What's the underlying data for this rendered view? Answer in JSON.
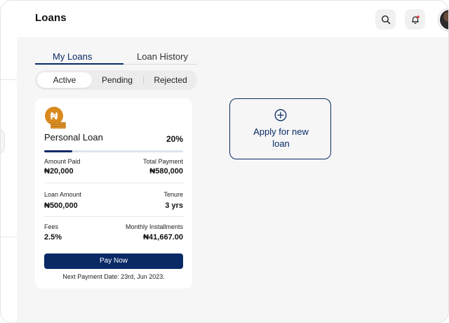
{
  "header": {
    "title": "Loans",
    "icons": [
      "search-icon",
      "bell-icon",
      "avatar"
    ],
    "notification_dot_color": "#e53935"
  },
  "tabs": [
    {
      "label": "My Loans",
      "selected": true
    },
    {
      "label": "Loan History",
      "selected": false
    }
  ],
  "status_filter": [
    {
      "label": "Active",
      "selected": true
    },
    {
      "label": "Pending",
      "selected": false
    },
    {
      "label": "Rejected",
      "selected": false
    }
  ],
  "loan_card": {
    "currency_symbol": "₦",
    "name": "Personal Loan",
    "progress_percent_label": "20%",
    "progress_fraction": 0.2,
    "amount_paid_label": "Amount Paid",
    "amount_paid": "₦20,000",
    "total_payment_label": "Total Payment",
    "total_payment": "₦580,000",
    "loan_amount_label": "Loan Amount",
    "loan_amount": "₦500,000",
    "tenure_label": "Tenure",
    "tenure": "3 yrs",
    "fees_label": "Fees",
    "fees": "2.5%",
    "monthly_label": "Monthly Installments",
    "monthly": "₦41,667.00",
    "pay_button": "Pay Now",
    "next_payment": "Next Payment Date: 23rd, Jun 2023."
  },
  "apply_card": {
    "icon": "plus-circle-icon",
    "label_line1": "Apply for new",
    "label_line2": "loan"
  },
  "colors": {
    "primary": "#0a2a66",
    "coin": "#d98a1e",
    "background": "#f6f6f6"
  }
}
